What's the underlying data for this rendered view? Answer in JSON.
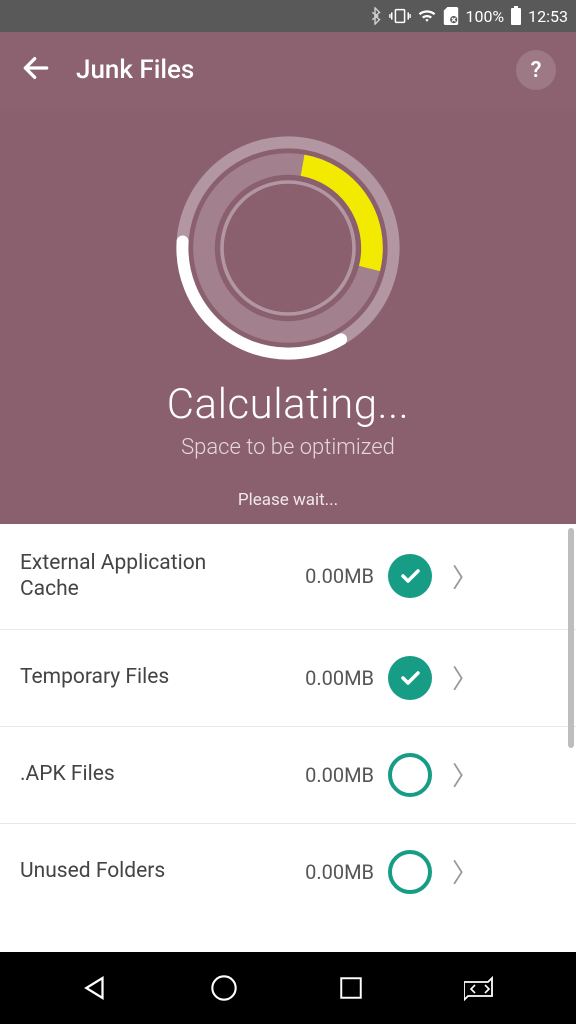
{
  "statusbar": {
    "battery_pct": "100%",
    "time": "12:53"
  },
  "header": {
    "title": "Junk Files",
    "help_label": "?"
  },
  "progress": {
    "title": "Calculating...",
    "subtitle": "Space to be optimized",
    "wait": "Please wait..."
  },
  "items": [
    {
      "label": "External Application Cache",
      "size": "0.00MB",
      "checked": true
    },
    {
      "label": "Temporary Files",
      "size": "0.00MB",
      "checked": true
    },
    {
      "label": ".APK Files",
      "size": "0.00MB",
      "checked": false
    },
    {
      "label": "Unused Folders",
      "size": "0.00MB",
      "checked": false
    }
  ]
}
